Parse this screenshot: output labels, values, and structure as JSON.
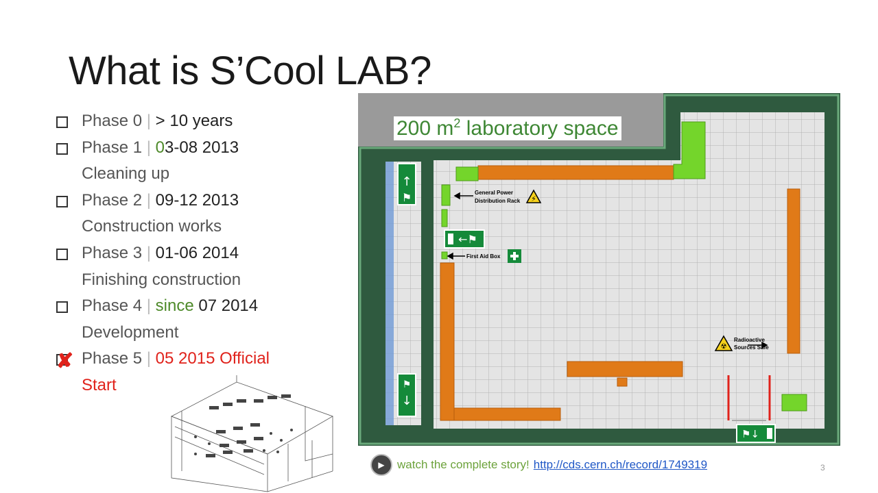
{
  "title": "What is S’Cool LAB?",
  "phases": [
    {
      "label": "Phase 0",
      "sep": "|",
      "date": "> 10 years",
      "desc": ""
    },
    {
      "label": "Phase 1",
      "sep": "|",
      "date_parts": [
        "0",
        "3-08 2013"
      ],
      "desc": "Cleaning up"
    },
    {
      "label": "Phase 2",
      "sep": "|",
      "date": "09-12 2013",
      "desc": "Construction works"
    },
    {
      "label": "Phase 3",
      "sep": "|",
      "date": "01-06 2014",
      "desc": "Finishing construction"
    },
    {
      "label": "Phase 4",
      "sep": "|",
      "since": "since",
      "date": "07 2014",
      "desc": "Development"
    },
    {
      "label": "Phase 5",
      "sep": "|",
      "date": "05 2015",
      "official": "Official",
      "desc": "Start"
    }
  ],
  "plan": {
    "area_number": "200 m",
    "area_sup": "2",
    "area_rest": " laboratory space",
    "labels": {
      "power1": "General Power",
      "power2": "Distribution Rack",
      "firstaid": "First Aid Box",
      "radio1": "Radioactive",
      "radio2": "Sources Safe"
    }
  },
  "footer": {
    "watch": "watch the complete story!",
    "link": "http://cds.cern.ch/record/1749319",
    "page": "3"
  },
  "colors": {
    "wall": "#2f5a3f",
    "floor": "#e2e2e2",
    "orange": "#e07a18",
    "green": "#74d52b",
    "red": "#e0221b",
    "accent_green": "#4e8a2a"
  }
}
